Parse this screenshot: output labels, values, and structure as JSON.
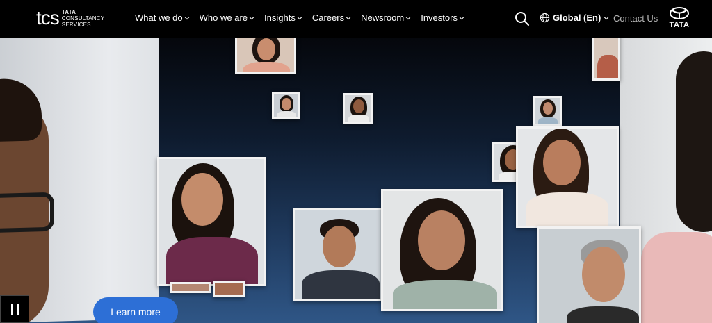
{
  "header": {
    "logo_mark": "tcs",
    "logo_line1": "TATA",
    "logo_line2": "CONSULTANCY",
    "logo_line3": "SERVICES",
    "nav": [
      {
        "label": "What we do"
      },
      {
        "label": "Who we are"
      },
      {
        "label": "Insights"
      },
      {
        "label": "Careers"
      },
      {
        "label": "Newsroom"
      },
      {
        "label": "Investors"
      }
    ],
    "region": "Global (En)",
    "contact": "Contact Us",
    "brand_word": "TATA"
  },
  "hero": {
    "learn_more": "Learn more"
  },
  "colors": {
    "accent": "#2d6fd6",
    "header_bg": "#000000",
    "contact_text": "#b9b9b9"
  },
  "icons": {
    "search": "search-icon",
    "globe": "globe-icon",
    "pause": "pause-icon"
  }
}
